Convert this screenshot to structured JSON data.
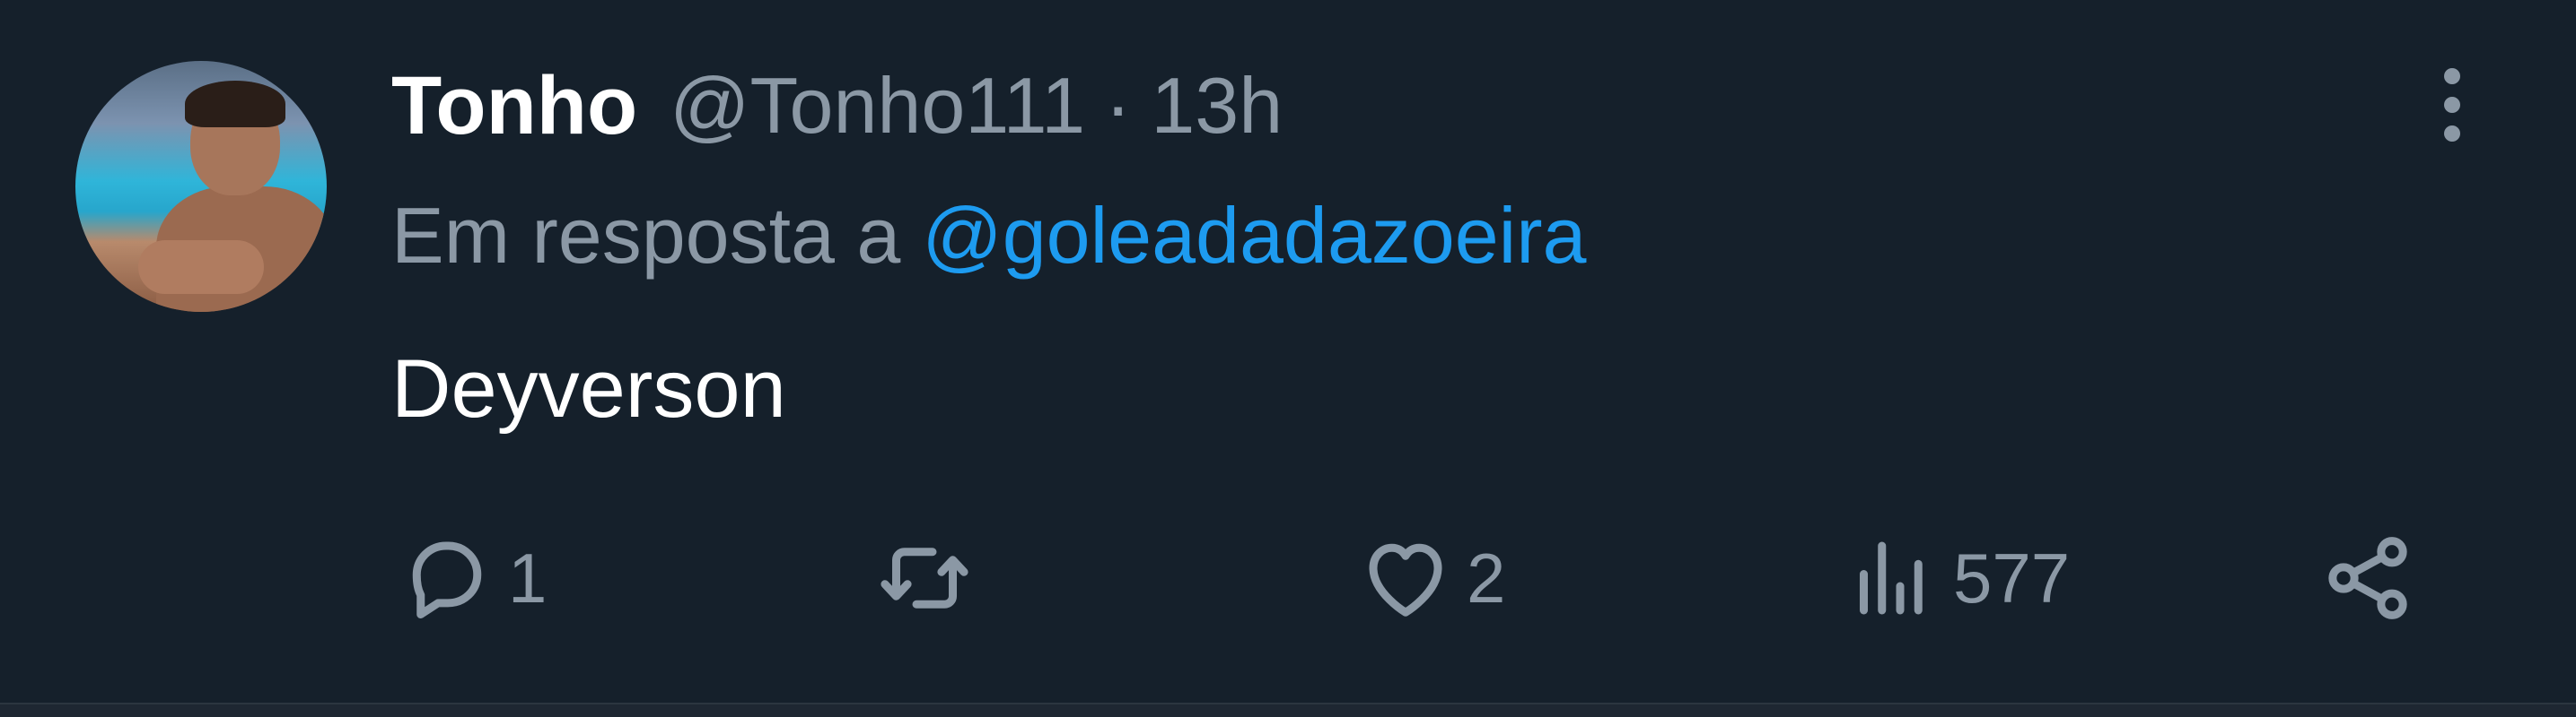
{
  "tweet": {
    "display_name": "Tonho",
    "handle": "@Tonho111",
    "separator": "·",
    "time": "13h",
    "reply_prefix": "Em resposta a",
    "reply_to": "@goleadadazoeira",
    "text": "Deyverson"
  },
  "actions": {
    "reply": {
      "icon": "reply-icon",
      "count": "1"
    },
    "retweet": {
      "icon": "retweet-icon",
      "count": ""
    },
    "like": {
      "icon": "heart-icon",
      "count": "2"
    },
    "views": {
      "icon": "views-icon",
      "count": "577"
    },
    "share": {
      "icon": "share-icon"
    }
  },
  "colors": {
    "background": "#15202b",
    "text_primary": "#ffffff",
    "text_secondary": "#8b98a5",
    "accent": "#1d9bf0"
  }
}
